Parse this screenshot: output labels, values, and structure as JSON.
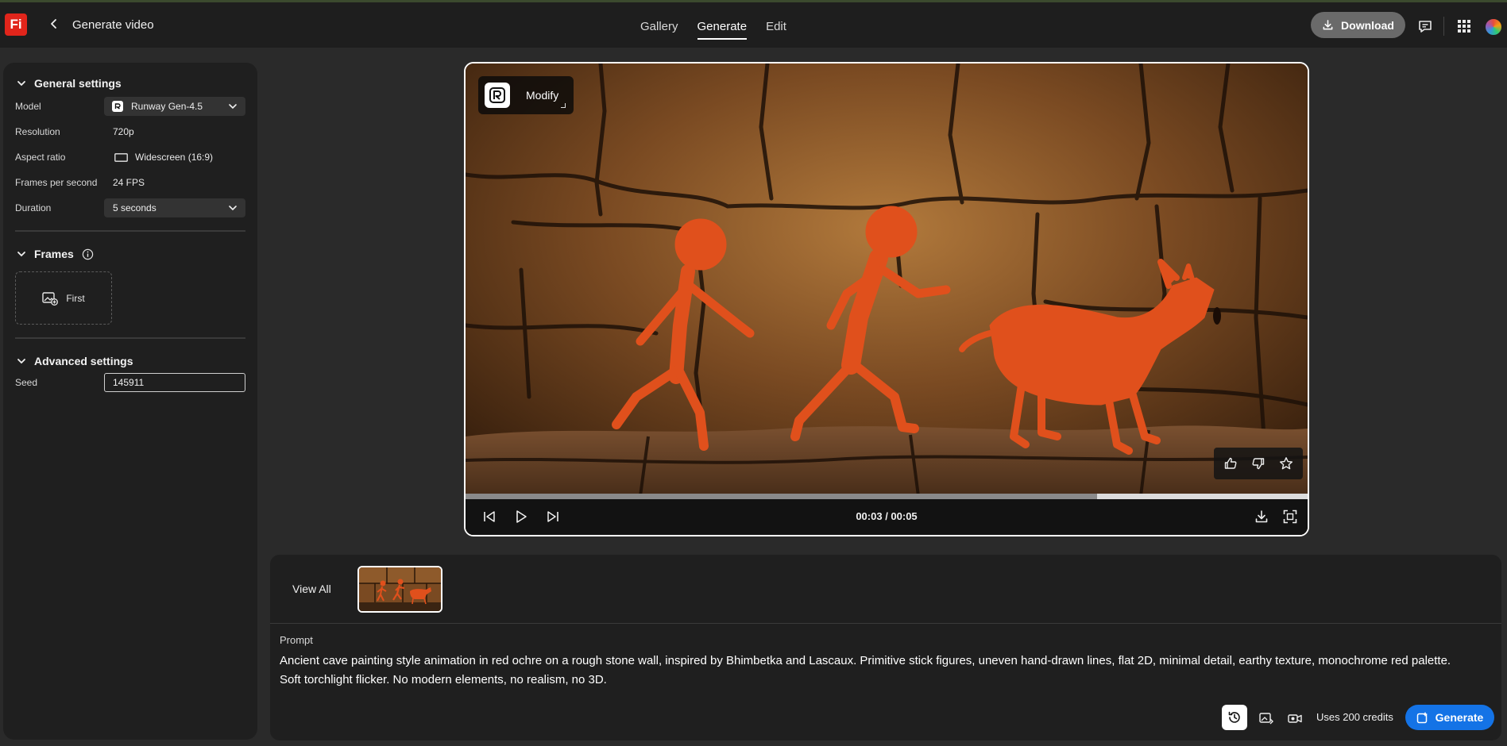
{
  "app": {
    "logo_text": "Fi",
    "title": "Generate video"
  },
  "nav": {
    "tabs": [
      {
        "label": "Gallery"
      },
      {
        "label": "Generate"
      },
      {
        "label": "Edit"
      }
    ],
    "active_tab": "Generate"
  },
  "header": {
    "download_label": "Download"
  },
  "general_settings": {
    "title": "General settings",
    "model_label": "Model",
    "model_value": "Runway Gen-4.5",
    "resolution_label": "Resolution",
    "resolution_value": "720p",
    "aspect_label": "Aspect ratio",
    "aspect_value": "Widescreen (16:9)",
    "fps_label": "Frames per second",
    "fps_value": "24 FPS",
    "duration_label": "Duration",
    "duration_value": "5 seconds"
  },
  "frames": {
    "title": "Frames",
    "first_label": "First"
  },
  "advanced_settings": {
    "title": "Advanced settings",
    "seed_label": "Seed",
    "seed_value": "145911"
  },
  "player": {
    "modify_label": "Modify",
    "time_text": "00:03 / 00:05",
    "progress_fraction": 0.75
  },
  "bottom": {
    "view_all_label": "View All",
    "prompt_label": "Prompt",
    "prompt_text": "Ancient cave painting style animation in red ochre on a rough stone wall, inspired by Bhimbetka and Lascaux. Primitive stick figures, uneven hand-drawn lines, flat 2D, minimal detail, earthy texture, monochrome red palette. Soft torchlight flicker. No modern elements, no realism, no 3D.",
    "credits_text": "Uses 200 credits",
    "generate_label": "Generate"
  },
  "colors": {
    "accent": "#1473e6",
    "brand": "#e1251b",
    "ochre": "#e0501c"
  },
  "icons": [
    "back-arrow-icon",
    "download-icon",
    "comment-icon",
    "apps-grid-icon",
    "chevron-down-icon",
    "runway-logo-icon",
    "widescreen-icon",
    "info-icon",
    "add-image-icon",
    "thumbs-up-icon",
    "thumbs-down-icon",
    "star-icon",
    "skip-back-icon",
    "play-icon",
    "skip-forward-icon",
    "fullscreen-icon",
    "history-icon",
    "image-settings-icon",
    "camera-icon",
    "generate-icon"
  ]
}
